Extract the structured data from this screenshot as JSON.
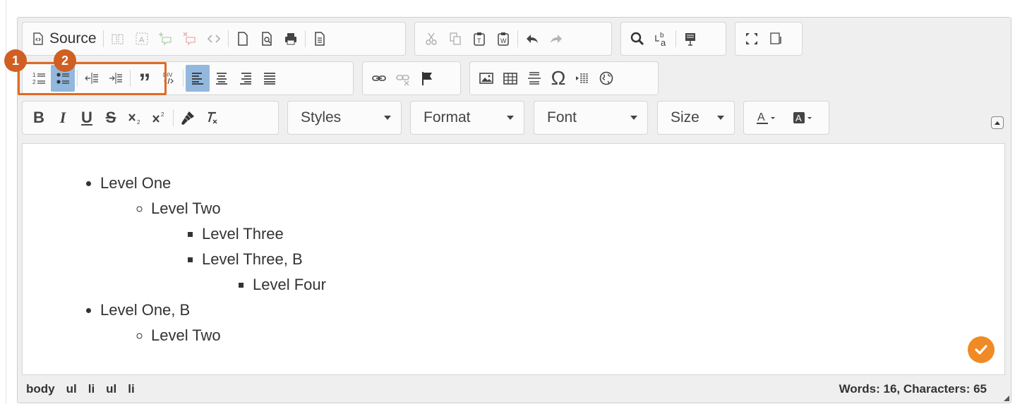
{
  "toolbar": {
    "source_label": "Source",
    "styles_label": "Styles",
    "format_label": "Format",
    "font_label": "Font",
    "size_label": "Size",
    "bold_glyph": "B",
    "italic_glyph": "I",
    "underline_glyph": "U",
    "strike_glyph": "S",
    "quote_glyph": "”",
    "omega_glyph": "Ω",
    "active_color": "#92b8de"
  },
  "callouts": {
    "numbered_list_marker": "1",
    "bulleted_list_marker": "2",
    "color": "#e06b22"
  },
  "content": {
    "items": [
      {
        "text": "Level One"
      },
      {
        "text": "Level Two"
      },
      {
        "text": "Level Three"
      },
      {
        "text": "Level Three, B"
      },
      {
        "text": "Level Four"
      },
      {
        "text": "Level One, B"
      },
      {
        "text": "Level Two"
      }
    ]
  },
  "status": {
    "path": [
      "body",
      "ul",
      "li",
      "ul",
      "li"
    ],
    "counts": "Words: 16, Characters: 65"
  },
  "accent_color": "#f08a24"
}
